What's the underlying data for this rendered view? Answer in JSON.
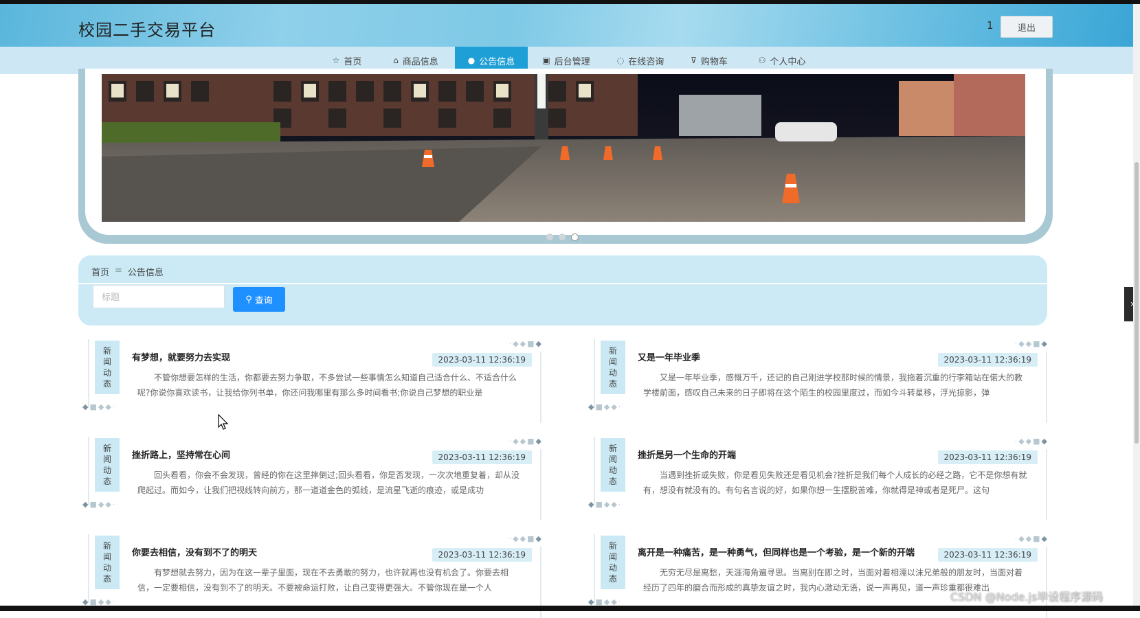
{
  "header": {
    "site_title": "校园二手交易平台",
    "user_name": "1",
    "logout_label": "退出"
  },
  "nav": {
    "items": [
      {
        "label": "首页",
        "icon": "star-icon"
      },
      {
        "label": "商品信息",
        "icon": "bag-icon"
      },
      {
        "label": "公告信息",
        "icon": "circle-icon",
        "active": true
      },
      {
        "label": "后台管理",
        "icon": "clipboard-icon"
      },
      {
        "label": "在线咨询",
        "icon": "headset-icon"
      },
      {
        "label": "购物车",
        "icon": "cart-icon"
      },
      {
        "label": "个人中心",
        "icon": "user-icon"
      }
    ]
  },
  "carousel": {
    "slide_count": 3,
    "active_index": 2
  },
  "breadcrumb": {
    "home": "首页",
    "separator": "≡",
    "current": "公告信息"
  },
  "search": {
    "placeholder": "标题",
    "value": "",
    "button_label": "查询"
  },
  "notices": [
    {
      "tag": [
        "新",
        "闻",
        "动",
        "态"
      ],
      "title": "有梦想，就要努力去实现",
      "date": "2023-03-11 12:36:19",
      "body": "不管你想要怎样的生活，你都要去努力争取，不多尝试一些事情怎么知道自己适合什么、不适合什么呢?你说你喜欢读书，让我给你列书单，你还问我哪里有那么多时间看书;你说自己梦想的职业是"
    },
    {
      "tag": [
        "新",
        "闻",
        "动",
        "态"
      ],
      "title": "又是一年毕业季",
      "date": "2023-03-11 12:36:19",
      "body": "又是一年毕业季，感慨万千，还记的自己刚进学校那时候的情景，我拖着沉重的行李箱站在偌大的教学楼前面，感叹自己未来的日子即将在这个陌生的校园里度过，而如今斗转星移，浮光掠影，弹"
    },
    {
      "tag": [
        "新",
        "闻",
        "动",
        "态"
      ],
      "title": "挫折路上，坚持常在心间",
      "date": "2023-03-11 12:36:19",
      "body": "回头看看，你会不会发现，曾经的你在这里摔倒过;回头看看，你是否发现，一次次地重复着，却从没爬起过。而如今，让我们把视线转向前方，那一道道金色的弧线，是流星飞逝的痕迹，或是成功"
    },
    {
      "tag": [
        "新",
        "闻",
        "动",
        "态"
      ],
      "title": "挫折是另一个生命的开端",
      "date": "2023-03-11 12:36:19",
      "body": "当遇到挫折或失败，你是看见失败还是看见机会?挫折是我们每个人成长的必经之路，它不是你想有就有，想没有就没有的。有句名言说的好，如果你想一生摆脱苦难，你就得是神或者是死尸。这句"
    },
    {
      "tag": [
        "新",
        "闻",
        "动",
        "态"
      ],
      "title": "你要去相信，没有到不了的明天",
      "date": "2023-03-11 12:36:19",
      "body": "有梦想就去努力，因为在这一辈子里面，现在不去勇敢的努力，也许就再也没有机会了。你要去相信，一定要相信，没有到不了的明天。不要被命运打败，让自己变得更强大。不管你现在是一个人"
    },
    {
      "tag": [
        "新",
        "闻",
        "动",
        "态"
      ],
      "title": "离开是一种痛苦，是一种勇气，但同样也是一个考验，是一个新的开端",
      "date": "2023-03-11 12:36:19",
      "body": "无穷无尽是离愁，天涯海角遍寻思。当离别在即之时，当面对着相濡以沫兄弟般的朋友时，当面对着经历了四年的磨合而形成的真挚友谊之时，我内心激动无语，说一声再见，道一声珍重都很难出"
    }
  ],
  "watermark": "CSDN @Node.js毕设程序源码",
  "colors": {
    "accent": "#1e9fd6",
    "button": "#1e90ff",
    "panel": "#cbeaf5",
    "nav_bg": "#cde8f4"
  }
}
